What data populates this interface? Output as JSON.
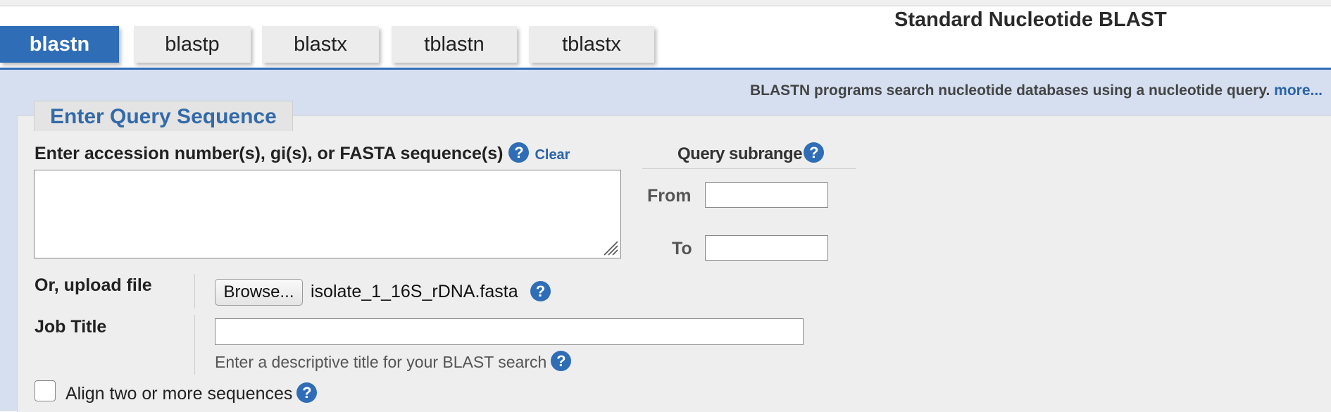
{
  "page_title": "Standard Nucleotide BLAST",
  "tabs": [
    {
      "label": "blastn",
      "active": true
    },
    {
      "label": "blastp",
      "active": false
    },
    {
      "label": "blastx",
      "active": false
    },
    {
      "label": "tblastn",
      "active": false
    },
    {
      "label": "tblastx",
      "active": false
    }
  ],
  "description": {
    "text": "BLASTN programs search nucleotide databases using a nucleotide query.",
    "more_link": "more..."
  },
  "section_title": "Enter Query Sequence",
  "query": {
    "label": "Enter accession number(s), gi(s), or FASTA sequence(s)",
    "clear_link": "Clear",
    "value": ""
  },
  "subrange": {
    "title": "Query subrange",
    "from_label": "From",
    "from_value": "",
    "to_label": "To",
    "to_value": ""
  },
  "upload": {
    "label": "Or, upload file",
    "browse_label": "Browse...",
    "filename": "isolate_1_16S_rDNA.fasta"
  },
  "job_title": {
    "label": "Job Title",
    "value": "",
    "hint": "Enter a descriptive title for your BLAST search"
  },
  "align": {
    "label": "Align two or more sequences",
    "checked": false
  },
  "help_glyph": "?",
  "colors": {
    "accent": "#2f6db6",
    "band": "#d5dff0",
    "panel": "#eeeeee",
    "legend_text": "#346aa8",
    "link": "#2a64a8"
  }
}
